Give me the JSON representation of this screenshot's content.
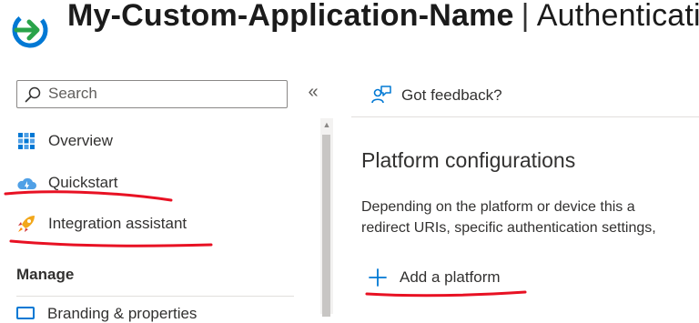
{
  "header": {
    "app_name": "My-Custom-Application-Name",
    "separator": "|",
    "blade_title": "Authenticatio"
  },
  "search": {
    "placeholder": "Search",
    "collapse_glyph": "«"
  },
  "sidebar": {
    "items": [
      {
        "label": "Overview",
        "icon": "overview-grid-icon"
      },
      {
        "label": "Quickstart",
        "icon": "cloud-quickstart-icon"
      },
      {
        "label": "Integration assistant",
        "icon": "rocket-icon"
      }
    ],
    "manage_header": "Manage",
    "partial_next_item": "Branding & properties"
  },
  "toolbar": {
    "feedback_label": "Got feedback?"
  },
  "main": {
    "section_title": "Platform configurations",
    "description_line1": "Depending on the platform or device this a",
    "description_line2": "redirect URIs, specific authentication settings,",
    "add_platform_label": "Add a platform"
  },
  "colors": {
    "accent": "#0078d4",
    "annotation": "#e81123",
    "logo_green": "#2aa34a"
  }
}
